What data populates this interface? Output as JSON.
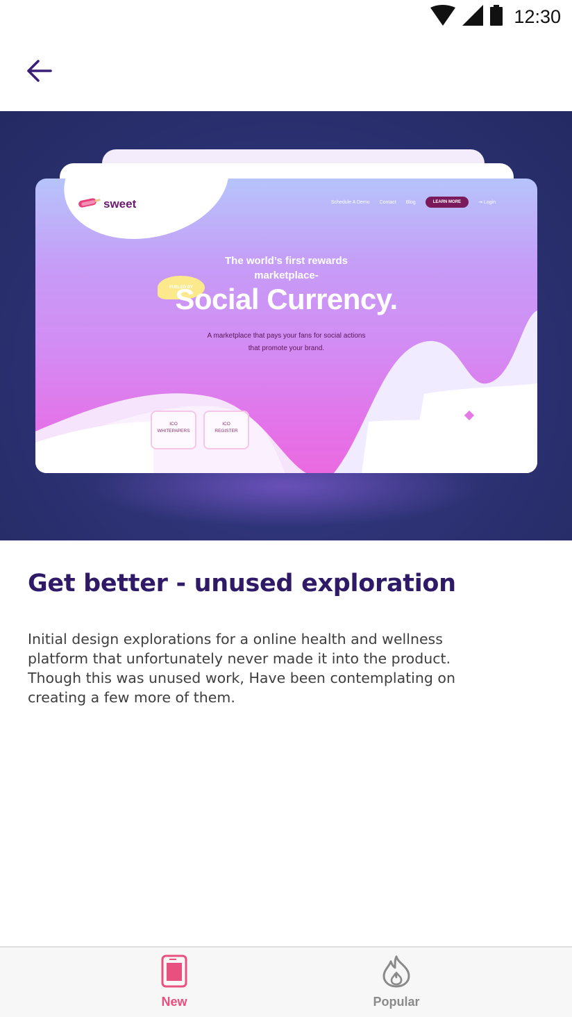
{
  "status_bar": {
    "time": "12:30",
    "icons": [
      "wifi-icon",
      "signal-icon",
      "battery-icon"
    ]
  },
  "app_bar": {
    "back_icon": "arrow-left-icon"
  },
  "hero": {
    "mockup": {
      "logo_text": "sweet",
      "nav_items": [
        "Schedule A Demo",
        "Contact",
        "Blog"
      ],
      "cta_label": "LEARN MORE",
      "login_label": "Login",
      "headline_line1": "The world’s first rewards",
      "headline_line2": "marketplace-",
      "badge": "FUELED BY",
      "big_title": "Social Currency.",
      "subtitle": "A marketplace that pays your fans for social actions that promote your brand.",
      "box1_line1": "ICO",
      "box1_line2": "WHITEPAPERS",
      "box2_line1": "ICO",
      "box2_line2": "REGISTER"
    }
  },
  "article": {
    "title": "Get better - unused exploration",
    "description_lines": [
      "Initial design explorations for a online health and wellness",
      "platform that unfortunately never made it into the product.",
      "Though this was unused work, Have been contemplating on",
      "creating a few more of them."
    ]
  },
  "bottom_nav": {
    "items": [
      {
        "label": "New",
        "icon": "tablet-icon",
        "active": true
      },
      {
        "label": "Popular",
        "icon": "flame-icon",
        "active": false
      }
    ]
  },
  "colors": {
    "accent": "#e8507f",
    "title": "#2e1a66",
    "inactive": "#8a8a8a",
    "hero_bg": "#2b3170"
  }
}
